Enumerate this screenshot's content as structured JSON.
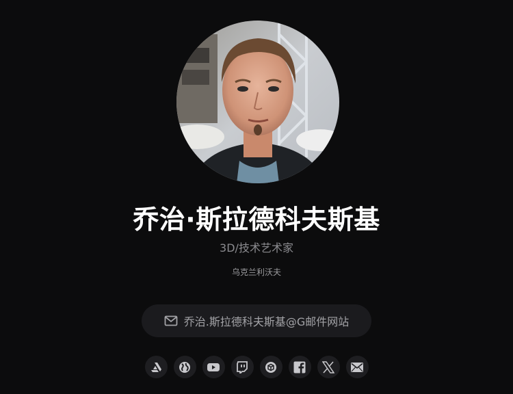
{
  "profile": {
    "name": "乔治·斯拉德科夫斯基",
    "title": "3D/技术艺术家",
    "location": "乌克兰利沃夫",
    "email": "乔治.斯拉德科夫斯基@G邮件网站",
    "avatar_icon": "profile-photo"
  },
  "social_links": [
    {
      "icon": "artstation-icon"
    },
    {
      "icon": "globe-icon"
    },
    {
      "icon": "youtube-icon"
    },
    {
      "icon": "twitch-icon"
    },
    {
      "icon": "sketchfab-icon"
    },
    {
      "icon": "facebook-icon"
    },
    {
      "icon": "x-icon"
    },
    {
      "icon": "email-icon"
    }
  ],
  "colors": {
    "background": "#0c0c0d",
    "name": "#ffffff",
    "muted_text": "#8b8b8f",
    "pill_background": "#1b1b1e",
    "icon_color": "#c8c8cc"
  }
}
